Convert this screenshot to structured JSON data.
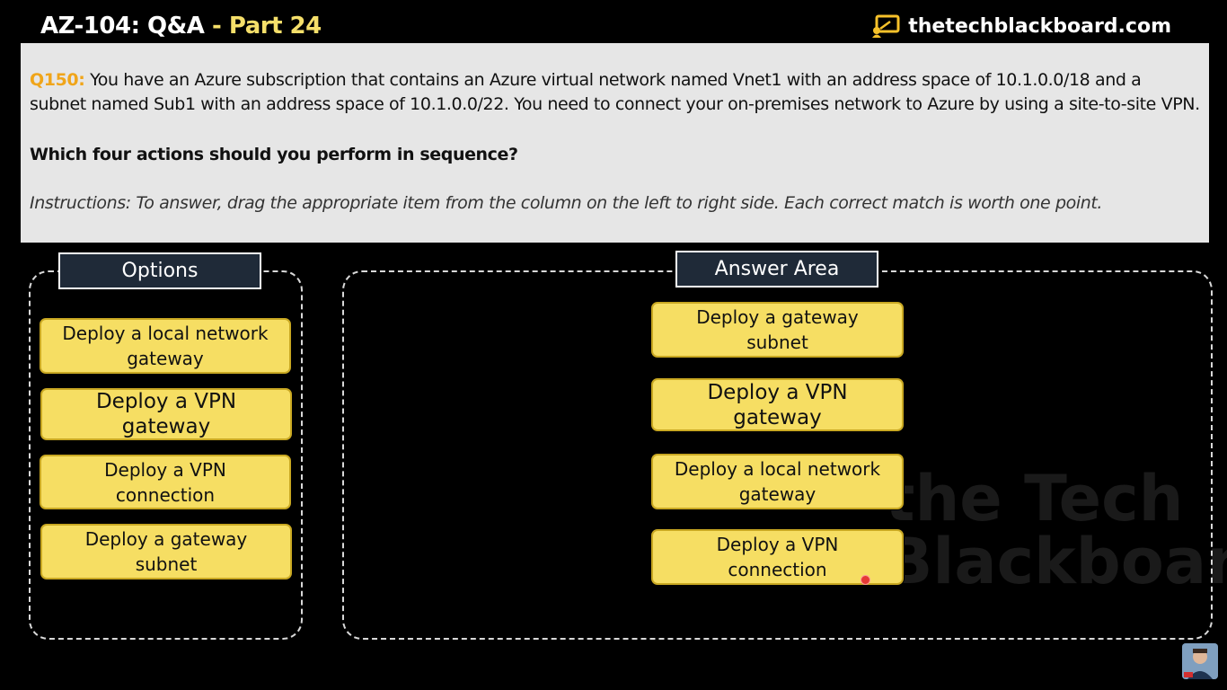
{
  "header": {
    "title": "AZ-104: Q&A",
    "separator": " - ",
    "part": "Part 24",
    "brand": "thetechblackboard.com"
  },
  "question": {
    "id": "Q150:",
    "text": "You have an Azure subscription that contains an Azure virtual network named Vnet1 with an address space of 10.1.0.0/18 and a subnet named Sub1 with an address space of 10.1.0.0/22. You need to connect your on-premises network to Azure by using a site-to-site VPN.",
    "prompt": "Which four actions should you perform in sequence?",
    "instructions": "Instructions: To answer, drag the appropriate item from the column on the left to right side. Each correct match is worth one point."
  },
  "options": {
    "heading": "Options",
    "items": [
      "Deploy a local network gateway",
      "Deploy a VPN gateway",
      "Deploy a VPN connection",
      "Deploy a gateway subnet"
    ]
  },
  "answer": {
    "heading": "Answer Area",
    "items": [
      "Deploy a gateway subnet",
      "Deploy a VPN gateway",
      "Deploy a local network gateway",
      "Deploy a VPN connection"
    ]
  },
  "watermark": {
    "line1": "the Tech",
    "line2": "Blackboard"
  },
  "colors": {
    "accent_yellow": "#f6de63",
    "question_id": "#f0a51a",
    "panel_bg": "#e6e6e6",
    "tag_bg": "#1f2a38"
  },
  "icons": {
    "brand_logo": "blackboard-logo-icon"
  }
}
